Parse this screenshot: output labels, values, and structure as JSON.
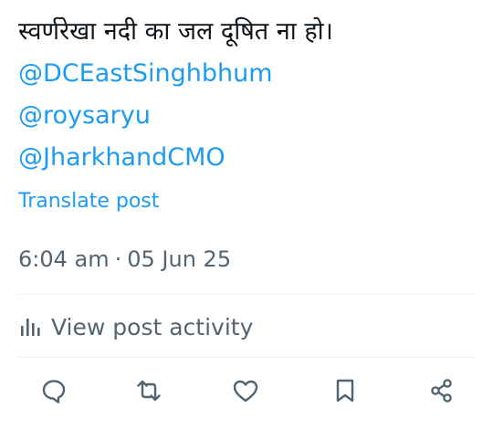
{
  "tweet": {
    "text_line": "स्वर्णरेखा नदी का जल दूषित ना हो।",
    "mentions": [
      "@DCEastSinghbhum",
      "@roysaryu",
      "@JharkhandCMO"
    ]
  },
  "translate_label": "Translate post",
  "meta": {
    "time": "6:04 am",
    "separator": "·",
    "date": "05 Jun 25"
  },
  "activity": {
    "label": "View post activity",
    "icon": "analytics-bars-icon"
  },
  "actions": [
    {
      "icon": "reply-bubble-icon"
    },
    {
      "icon": "repost-arrows-icon"
    },
    {
      "icon": "like-heart-icon"
    },
    {
      "icon": "bookmark-icon"
    },
    {
      "icon": "share-icon"
    }
  ],
  "colors": {
    "link": "#1d9bf0",
    "text": "#0f1419",
    "secondary": "#536471",
    "divider": "#eff3f4"
  }
}
